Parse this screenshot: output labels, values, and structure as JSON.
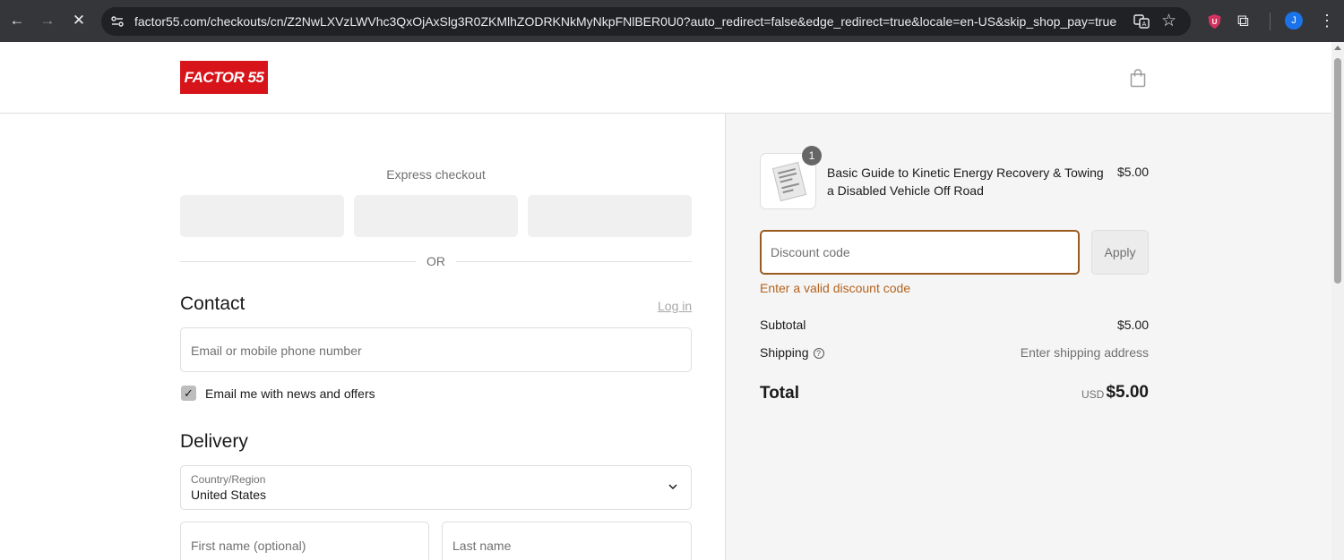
{
  "browser": {
    "url": "factor55.com/checkouts/cn/Z2NwLXVzLWVhc3QxOjAxSlg3R0ZKMlhZODRKNkMyNkpFNlBER0U0?auto_redirect=false&edge_redirect=true&locale=en-US&skip_shop_pay=true",
    "profile_initial": "J",
    "icons": [
      "back-icon",
      "forward-icon",
      "stop-icon",
      "site-info-icon",
      "translate-icon",
      "star-icon",
      "shield-extension-icon",
      "puzzle-icon",
      "kebab-menu-icon"
    ]
  },
  "header": {
    "logo_text": "FACTOR 55",
    "brand_color": "#d7141a"
  },
  "checkout": {
    "express_title": "Express checkout",
    "or_text": "OR",
    "contact": {
      "title": "Contact",
      "login_label": "Log in",
      "email_placeholder": "Email or mobile phone number",
      "newsletter_label": "Email me with news and offers",
      "newsletter_checked": true
    },
    "delivery": {
      "title": "Delivery",
      "country_label": "Country/Region",
      "country_value": "United States",
      "first_name_placeholder": "First name (optional)",
      "last_name_placeholder": "Last name"
    }
  },
  "summary": {
    "item": {
      "quantity": "1",
      "name": "Basic Guide to Kinetic Energy Recovery & Towing a Disabled Vehicle Off Road",
      "price": "$5.00"
    },
    "discount": {
      "placeholder": "Discount code",
      "apply_label": "Apply",
      "error": "Enter a valid discount code",
      "accent_color": "#9b5b1f"
    },
    "subtotal_label": "Subtotal",
    "subtotal_value": "$5.00",
    "shipping_label": "Shipping",
    "shipping_value": "Enter shipping address",
    "total_label": "Total",
    "total_currency": "USD",
    "total_value": "$5.00"
  }
}
